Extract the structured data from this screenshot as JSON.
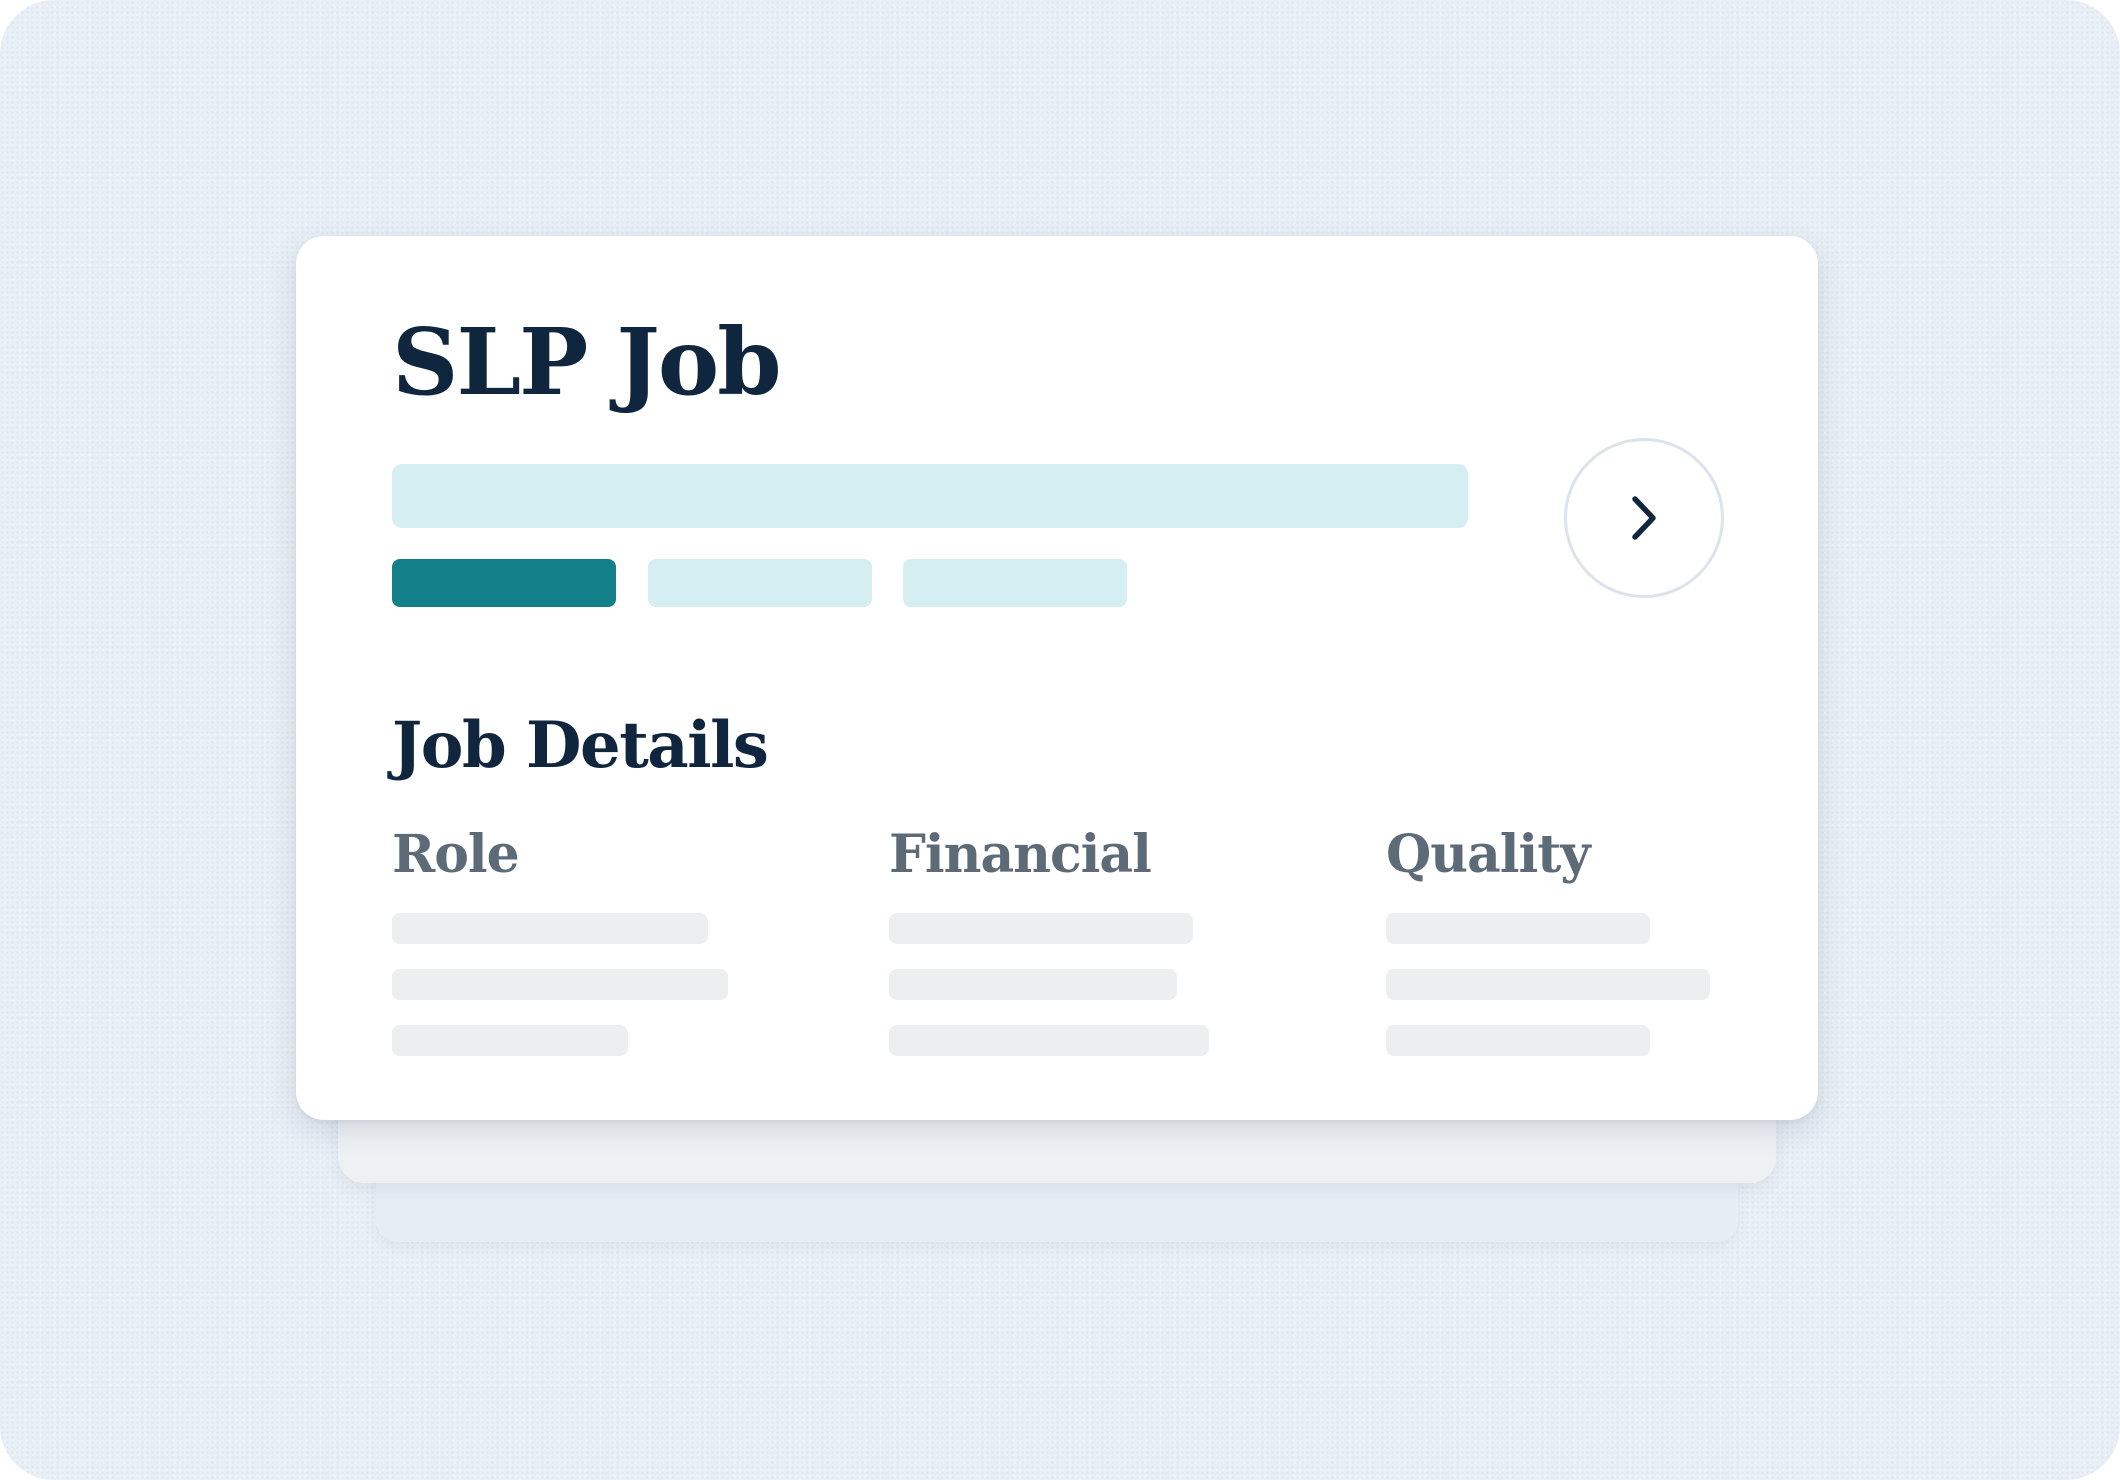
{
  "card": {
    "title": "SLP Job",
    "next_button_icon": "chevron-right-icon"
  },
  "details": {
    "heading": "Job Details",
    "columns": [
      {
        "label": "Role"
      },
      {
        "label": "Financial"
      },
      {
        "label": "Quality"
      }
    ]
  },
  "colors": {
    "background": "#e9eff6",
    "card": "#ffffff",
    "title": "#10263f",
    "accent": "#137f88",
    "accent_light": "#d5eef1",
    "muted_heading": "#5d6a78",
    "skeleton": "#eceeef"
  }
}
